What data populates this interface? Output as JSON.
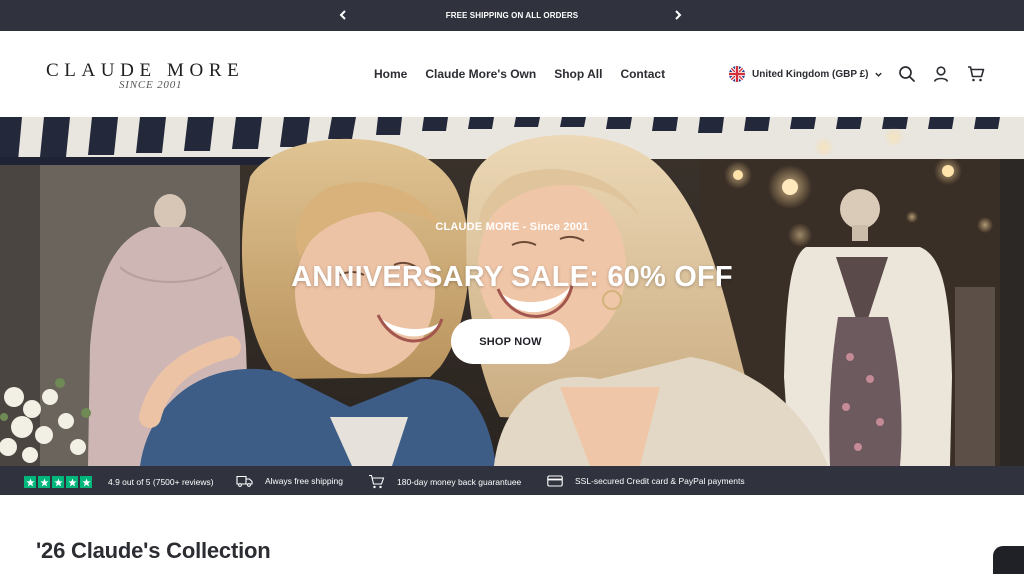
{
  "announcement": {
    "text": "FREE SHIPPING ON ALL ORDERS",
    "prev_icon": "chevron-left-icon",
    "next_icon": "chevron-right-icon"
  },
  "header": {
    "logo": {
      "name": "CLAUDE MORE",
      "tagline": "SINCE 2001"
    },
    "nav": [
      "Home",
      "Claude More's Own",
      "Shop All",
      "Contact"
    ],
    "locale": {
      "label": "United Kingdom (GBP £)",
      "flag": "uk-flag-icon"
    },
    "icons": [
      "search-icon",
      "account-icon",
      "cart-icon"
    ]
  },
  "hero": {
    "eyebrow": "CLAUDE MORE - Since 2001",
    "title": "ANNIVERSARY SALE: 60% OFF",
    "cta": "SHOP NOW"
  },
  "trust_bar": {
    "rating_text": "4.9 out of 5 (7500+ reviews)",
    "stars": 5,
    "shipping_text": "Always free shipping",
    "money_back_text": "180-day money back guarantuee",
    "payment_text": "SSL-secured Credit card & PayPal payments"
  },
  "collection": {
    "title": "'26 Claude's Collection"
  },
  "colors": {
    "bar_background": "#30333d",
    "star_green": "#00b67a",
    "text_dark": "#2b2d33"
  }
}
